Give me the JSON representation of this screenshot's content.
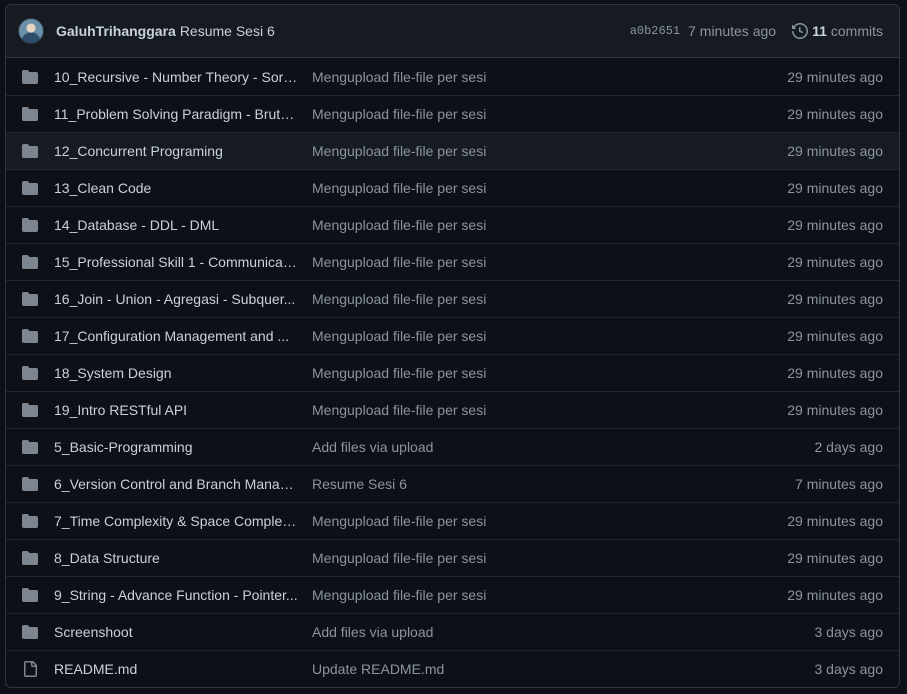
{
  "header": {
    "author": "GaluhTrihanggara",
    "message": "Resume Sesi 6",
    "sha": "a0b2651",
    "time": "7 minutes ago",
    "commit_count": "11",
    "commits_label": "commits",
    "folder_color": "#7d8590"
  },
  "files": [
    {
      "type": "folder",
      "name": "10_Recursive - Number Theory - Sort...",
      "message": "Mengupload file-file per sesi",
      "age": "29 minutes ago"
    },
    {
      "type": "folder",
      "name": "11_Problem Solving Paradigm - Brute...",
      "message": "Mengupload file-file per sesi",
      "age": "29 minutes ago"
    },
    {
      "type": "folder",
      "name": "12_Concurrent Programing",
      "message": "Mengupload file-file per sesi",
      "age": "29 minutes ago"
    },
    {
      "type": "folder",
      "name": "13_Clean Code",
      "message": "Mengupload file-file per sesi",
      "age": "29 minutes ago"
    },
    {
      "type": "folder",
      "name": "14_Database - DDL - DML",
      "message": "Mengupload file-file per sesi",
      "age": "29 minutes ago"
    },
    {
      "type": "folder",
      "name": "15_Professional Skill 1 - Communicati...",
      "message": "Mengupload file-file per sesi",
      "age": "29 minutes ago"
    },
    {
      "type": "folder",
      "name": "16_Join - Union - Agregasi - Subquer...",
      "message": "Mengupload file-file per sesi",
      "age": "29 minutes ago"
    },
    {
      "type": "folder",
      "name": "17_Configuration Management and ...",
      "message": "Mengupload file-file per sesi",
      "age": "29 minutes ago"
    },
    {
      "type": "folder",
      "name": "18_System Design",
      "message": "Mengupload file-file per sesi",
      "age": "29 minutes ago"
    },
    {
      "type": "folder",
      "name": "19_Intro RESTful API",
      "message": "Mengupload file-file per sesi",
      "age": "29 minutes ago"
    },
    {
      "type": "folder",
      "name": "5_Basic-Programming",
      "message": "Add files via upload",
      "age": "2 days ago"
    },
    {
      "type": "folder",
      "name": "6_Version Control and Branch Manag...",
      "message": "Resume Sesi 6",
      "age": "7 minutes ago"
    },
    {
      "type": "folder",
      "name": "7_Time Complexity & Space Complex...",
      "message": "Mengupload file-file per sesi",
      "age": "29 minutes ago"
    },
    {
      "type": "folder",
      "name": "8_Data Structure",
      "message": "Mengupload file-file per sesi",
      "age": "29 minutes ago"
    },
    {
      "type": "folder",
      "name": "9_String - Advance Function - Pointer...",
      "message": "Mengupload file-file per sesi",
      "age": "29 minutes ago"
    },
    {
      "type": "folder",
      "name": "Screenshoot",
      "message": "Add files via upload",
      "age": "3 days ago"
    },
    {
      "type": "file",
      "name": "README.md",
      "message": "Update README.md",
      "age": "3 days ago"
    }
  ]
}
